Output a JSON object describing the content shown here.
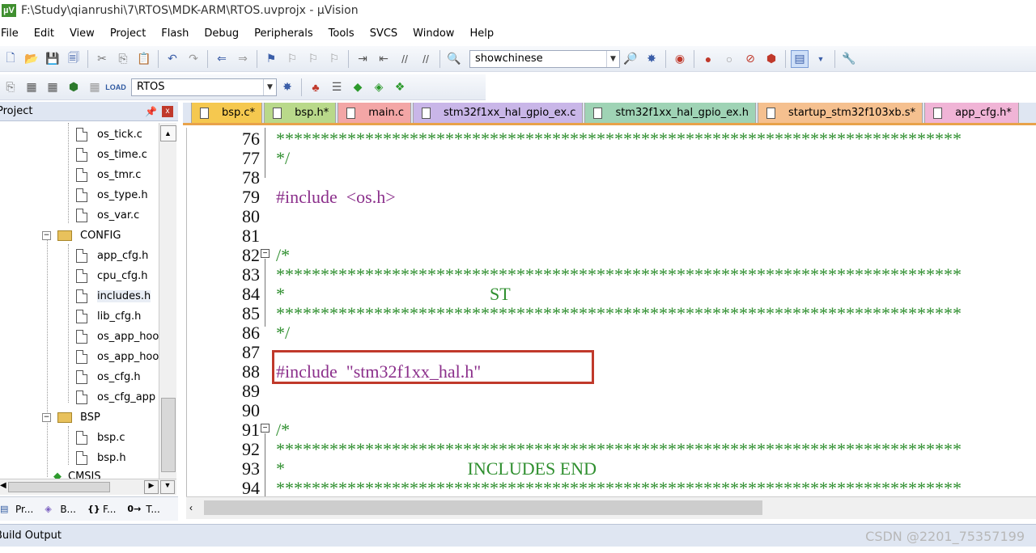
{
  "window": {
    "title": "F:\\Study\\qianrushi\\7\\RTOS\\MDK-ARM\\RTOS.uvprojx - µVision",
    "app_icon": "keil-uvision-icon"
  },
  "menu": [
    "File",
    "Edit",
    "View",
    "Project",
    "Flash",
    "Debug",
    "Peripherals",
    "Tools",
    "SVCS",
    "Window",
    "Help"
  ],
  "toolbar1": {
    "find_combo_value": "showchinese"
  },
  "toolbar2": {
    "target_combo_value": "RTOS"
  },
  "project_panel": {
    "title": "Project",
    "pin": "⬮",
    "close": "x",
    "items": [
      {
        "label": "os_tick.c",
        "type": "file"
      },
      {
        "label": "os_time.c",
        "type": "file"
      },
      {
        "label": "os_tmr.c",
        "type": "file"
      },
      {
        "label": "os_type.h",
        "type": "file"
      },
      {
        "label": "os_var.c",
        "type": "file"
      },
      {
        "label": "CONFIG",
        "type": "folder"
      },
      {
        "label": "app_cfg.h",
        "type": "file"
      },
      {
        "label": "cpu_cfg.h",
        "type": "file"
      },
      {
        "label": "includes.h",
        "type": "file"
      },
      {
        "label": "lib_cfg.h",
        "type": "file"
      },
      {
        "label": "os_app_hoo",
        "type": "file"
      },
      {
        "label": "os_app_hoo",
        "type": "file"
      },
      {
        "label": "os_cfg.h",
        "type": "file"
      },
      {
        "label": "os_cfg_app",
        "type": "file"
      },
      {
        "label": "BSP",
        "type": "folder"
      },
      {
        "label": "bsp.c",
        "type": "file"
      },
      {
        "label": "bsp.h",
        "type": "file"
      },
      {
        "label": "CMSIS",
        "type": "component"
      }
    ],
    "bottom_tabs": [
      {
        "label": "Pr...",
        "icon": "project-icon"
      },
      {
        "label": "B...",
        "icon": "books-icon"
      },
      {
        "label": "F...",
        "icon": "functions-icon",
        "glyph": "{}"
      },
      {
        "label": "T...",
        "icon": "templates-icon",
        "glyph": "0→"
      }
    ]
  },
  "editor_tabs": [
    {
      "label": "bsp.c*",
      "color": "#f5c84f"
    },
    {
      "label": "bsp.h*",
      "color": "#b9d98a"
    },
    {
      "label": "main.c",
      "color": "#f3a6a6"
    },
    {
      "label": "stm32f1xx_hal_gpio_ex.c",
      "color": "#c9b6e8"
    },
    {
      "label": "stm32f1xx_hal_gpio_ex.h",
      "color": "#9fd3b5"
    },
    {
      "label": "startup_stm32f103xb.s*",
      "color": "#f5c08f"
    },
    {
      "label": "app_cfg.h*",
      "color": "#f0b4d6"
    }
  ],
  "code_lines": [
    {
      "n": "76",
      "text": "*****************************************************************************"
    },
    {
      "n": "77",
      "text": "*/"
    },
    {
      "n": "78",
      "text": ""
    },
    {
      "n": "79",
      "text": "#include  <os.h>"
    },
    {
      "n": "80",
      "text": ""
    },
    {
      "n": "81",
      "text": ""
    },
    {
      "n": "82",
      "text": "/*"
    },
    {
      "n": "83",
      "text": "*****************************************************************************"
    },
    {
      "n": "84",
      "text": "*                                              ST"
    },
    {
      "n": "85",
      "text": "*****************************************************************************"
    },
    {
      "n": "86",
      "text": "*/"
    },
    {
      "n": "87",
      "text": ""
    },
    {
      "n": "88",
      "text": "#include  \"stm32f1xx_hal.h\""
    },
    {
      "n": "89",
      "text": ""
    },
    {
      "n": "90",
      "text": ""
    },
    {
      "n": "91",
      "text": "/*"
    },
    {
      "n": "92",
      "text": "*****************************************************************************"
    },
    {
      "n": "93",
      "text": "*                                         INCLUDES END"
    },
    {
      "n": "94",
      "text": "*****************************************************************************"
    }
  ],
  "bottom_panel": {
    "title": "Build Output",
    "watermark": "CSDN @2201_75357199"
  }
}
